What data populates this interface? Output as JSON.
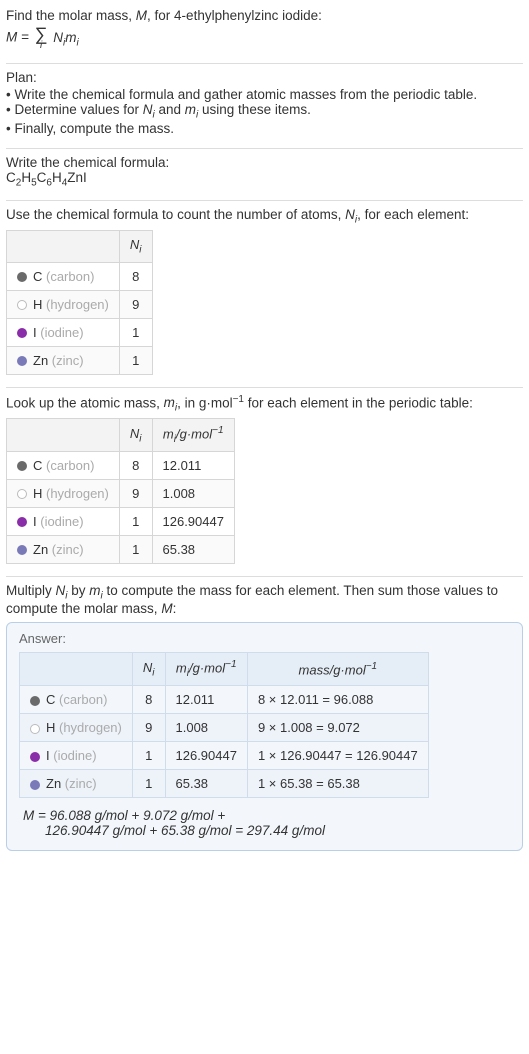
{
  "intro": {
    "line1_pre": "Find the molar mass, ",
    "line1_mid": ", for 4-ethylphenylzinc iodide:",
    "M": "M",
    "eq": " = ",
    "sum_index": "i",
    "Ni": "N",
    "mi": "m"
  },
  "plan": {
    "title": "Plan:",
    "items": [
      "• Write the chemical formula and gather atomic masses from the periodic table.",
      "• Determine values for N_i and m_i using these items.",
      "• Finally, compute the mass."
    ],
    "item2_pre": "• Determine values for ",
    "item2_mid": " and ",
    "item2_post": " using these items."
  },
  "write_formula": {
    "title": "Write the chemical formula:",
    "formula_parts": [
      "C",
      "2",
      "H",
      "5",
      "C",
      "6",
      "H",
      "4",
      "ZnI"
    ]
  },
  "count_atoms": {
    "title_pre": "Use the chemical formula to count the number of atoms, ",
    "title_post": ", for each element:",
    "header": "N",
    "rows": [
      {
        "color": "#6a6a6a",
        "sym": "C",
        "name": "(carbon)",
        "n": "8"
      },
      {
        "open": true,
        "sym": "H",
        "name": "(hydrogen)",
        "n": "9"
      },
      {
        "color": "#8a2da8",
        "sym": "I",
        "name": "(iodine)",
        "n": "1"
      },
      {
        "color": "#7a7ab8",
        "sym": "Zn",
        "name": "(zinc)",
        "n": "1"
      }
    ]
  },
  "atomic_mass": {
    "title_pre": "Look up the atomic mass, ",
    "title_mid": ", in g·mol",
    "title_post": " for each element in the periodic table:",
    "h1": "N",
    "h2": "m",
    "h2_units": "/g·mol",
    "rows": [
      {
        "color": "#6a6a6a",
        "sym": "C",
        "name": "(carbon)",
        "n": "8",
        "m": "12.011"
      },
      {
        "open": true,
        "sym": "H",
        "name": "(hydrogen)",
        "n": "9",
        "m": "1.008"
      },
      {
        "color": "#8a2da8",
        "sym": "I",
        "name": "(iodine)",
        "n": "1",
        "m": "126.90447"
      },
      {
        "color": "#7a7ab8",
        "sym": "Zn",
        "name": "(zinc)",
        "n": "1",
        "m": "65.38"
      }
    ]
  },
  "multiply": {
    "text_pre": "Multiply ",
    "text_mid": " by ",
    "text_post": " to compute the mass for each element. Then sum those values to compute the molar mass, ",
    "text_end": ":"
  },
  "answer": {
    "title": "Answer:",
    "h1": "N",
    "h2": "m",
    "h2_units": "/g·mol",
    "h3": "mass/g·mol",
    "rows": [
      {
        "color": "#6a6a6a",
        "sym": "C",
        "name": "(carbon)",
        "n": "8",
        "m": "12.011",
        "calc": "8 × 12.011 = 96.088"
      },
      {
        "open": true,
        "sym": "H",
        "name": "(hydrogen)",
        "n": "9",
        "m": "1.008",
        "calc": "9 × 1.008 = 9.072"
      },
      {
        "color": "#8a2da8",
        "sym": "I",
        "name": "(iodine)",
        "n": "1",
        "m": "126.90447",
        "calc": "1 × 126.90447 = 126.90447"
      },
      {
        "color": "#7a7ab8",
        "sym": "Zn",
        "name": "(zinc)",
        "n": "1",
        "m": "65.38",
        "calc": "1 × 65.38 = 65.38"
      }
    ],
    "final_line1": "M = 96.088 g/mol + 9.072 g/mol +",
    "final_line2": "126.90447 g/mol + 65.38 g/mol = 297.44 g/mol"
  }
}
